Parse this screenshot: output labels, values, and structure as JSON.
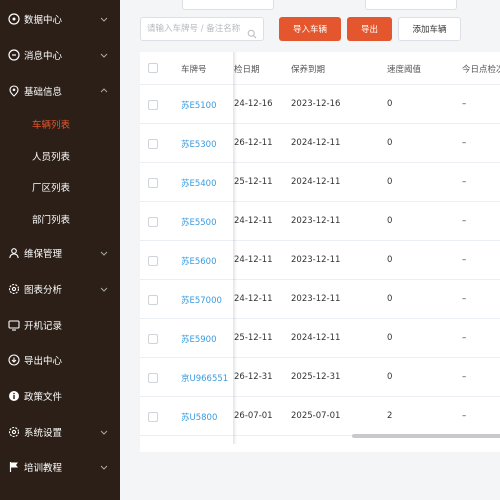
{
  "sidebar": {
    "items": [
      {
        "label": "数据中心",
        "icon": "database-icon",
        "expandable": true
      },
      {
        "label": "消息中心",
        "icon": "message-icon",
        "expandable": true
      },
      {
        "label": "基础信息",
        "icon": "location-pin-icon",
        "expandable": true,
        "expanded": true,
        "children": [
          {
            "label": "车辆列表",
            "active": true
          },
          {
            "label": "人员列表"
          },
          {
            "label": "厂区列表"
          },
          {
            "label": "部门列表"
          }
        ]
      },
      {
        "label": "维保管理",
        "icon": "user-icon",
        "expandable": true
      },
      {
        "label": "图表分析",
        "icon": "gear-icon",
        "expandable": true
      },
      {
        "label": "开机记录",
        "icon": "monitor-icon",
        "expandable": false
      },
      {
        "label": "导出中心",
        "icon": "export-icon",
        "expandable": false
      },
      {
        "label": "政策文件",
        "icon": "info-icon",
        "expandable": false
      },
      {
        "label": "系统设置",
        "icon": "settings-icon",
        "expandable": true
      },
      {
        "label": "培训教程",
        "icon": "flag-icon",
        "expandable": true
      }
    ]
  },
  "toolbar": {
    "search_placeholder": "请输入车牌号 / 备注名称",
    "import_label": "导入车辆",
    "export_label": "导出",
    "add_label": "添加车辆"
  },
  "table": {
    "columns": [
      "车牌号",
      "检日期",
      "保养到期",
      "速度阈值",
      "今日点检次"
    ],
    "rows": [
      {
        "plate": "苏E5100",
        "inspect": "24-12-16",
        "maint": "2023-12-16",
        "speed": "0",
        "check": "–"
      },
      {
        "plate": "苏E5300",
        "inspect": "26-12-11",
        "maint": "2024-12-11",
        "speed": "0",
        "check": "–"
      },
      {
        "plate": "苏E5400",
        "inspect": "25-12-11",
        "maint": "2024-12-11",
        "speed": "0",
        "check": "–"
      },
      {
        "plate": "苏E5500",
        "inspect": "24-12-11",
        "maint": "2023-12-11",
        "speed": "0",
        "check": "–"
      },
      {
        "plate": "苏E5600",
        "inspect": "24-12-11",
        "maint": "2023-12-11",
        "speed": "0",
        "check": "–"
      },
      {
        "plate": "苏E57000",
        "inspect": "24-12-11",
        "maint": "2023-12-11",
        "speed": "0",
        "check": "–"
      },
      {
        "plate": "苏E5900",
        "inspect": "25-12-11",
        "maint": "2024-12-11",
        "speed": "0",
        "check": "–"
      },
      {
        "plate": "京U966551",
        "inspect": "26-12-31",
        "maint": "2025-12-31",
        "speed": "0",
        "check": "–"
      },
      {
        "plate": "苏U5800",
        "inspect": "26-07-01",
        "maint": "2025-07-01",
        "speed": "2",
        "check": "–"
      }
    ]
  },
  "colors": {
    "sidebar_bg": "#2b1f17",
    "accent": "#e4572e",
    "link": "#3a9be0"
  }
}
